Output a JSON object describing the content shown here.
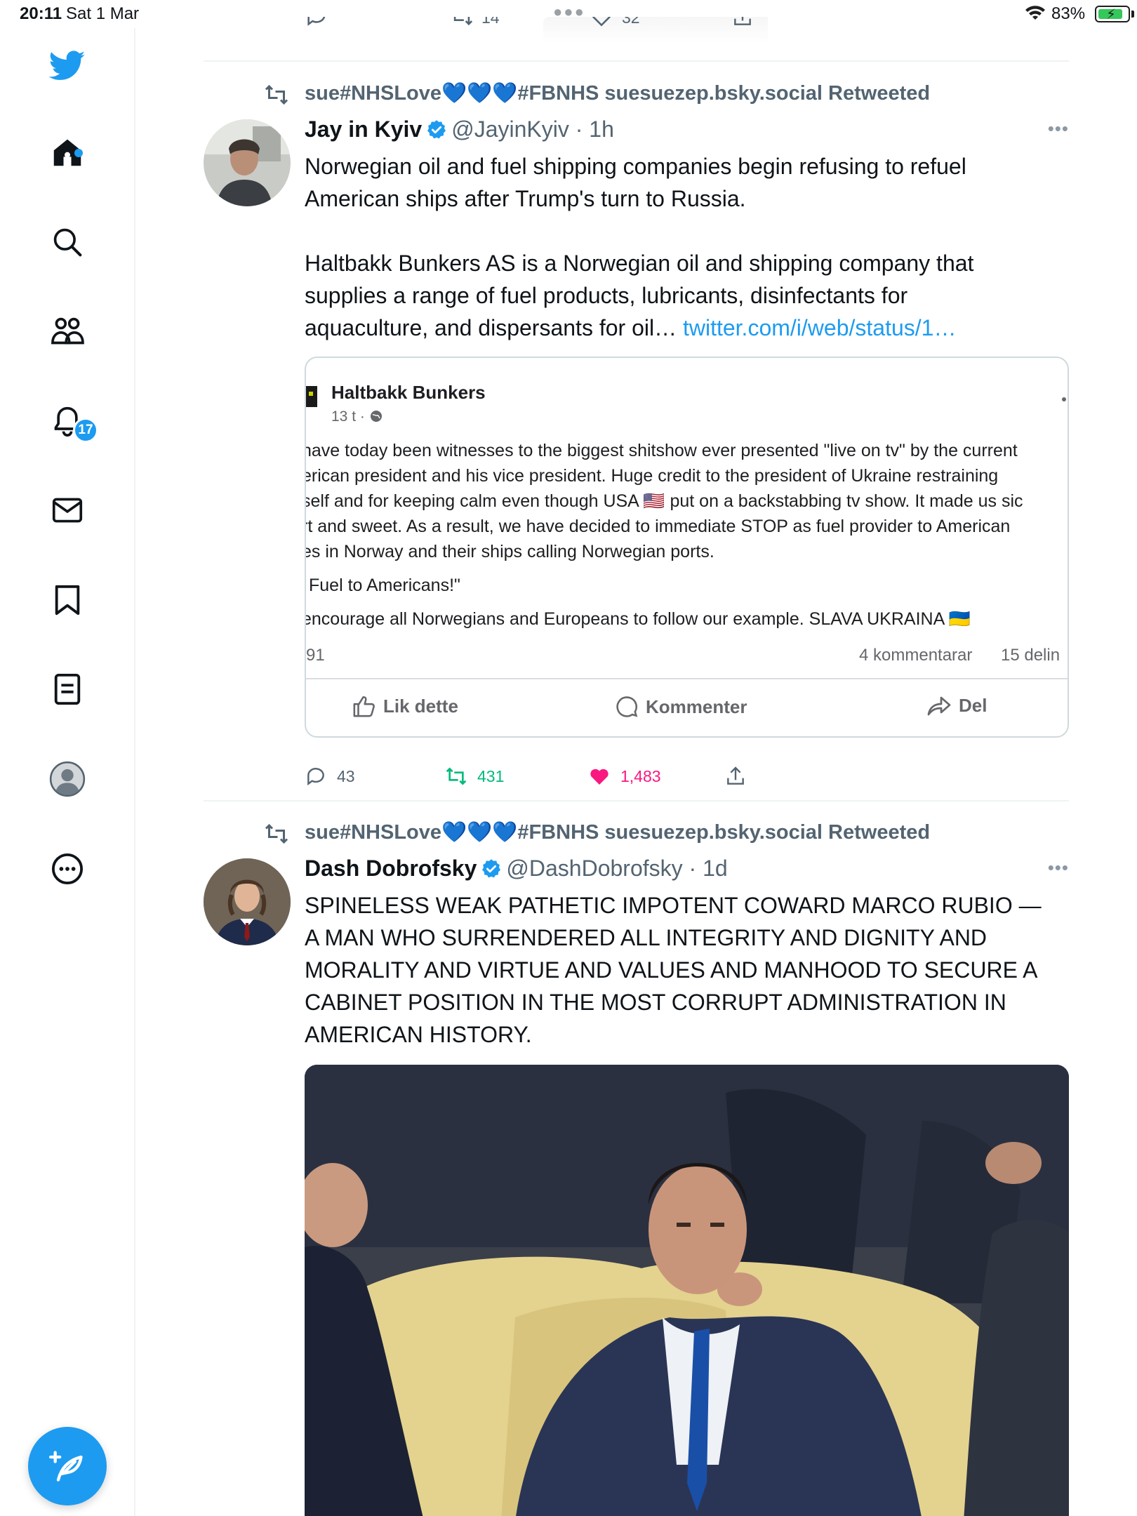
{
  "status_bar": {
    "time": "20:11",
    "date": "Sat 1 Mar",
    "battery": "83%"
  },
  "sidebar": {
    "notifications_badge": "17",
    "items": [
      "twitter-logo",
      "home-icon",
      "search-icon",
      "communities-icon",
      "notifications-icon",
      "messages-icon",
      "bookmarks-icon",
      "lists-icon",
      "profile-icon",
      "more-icon"
    ]
  },
  "top_partial_tweet": {
    "retweets": "14",
    "likes": "32"
  },
  "tweets": [
    {
      "retweeted_by": "sue#NHSLove💙💙💙#FBNHS suesuezep.bsky.social Retweeted",
      "name": "Jay in Kyiv",
      "handle": "@JayinKyiv",
      "time": "· 1h",
      "body_line1": "Norwegian oil and fuel shipping companies begin refusing to refuel",
      "body_line2": "American ships after Trump's turn to Russia.",
      "body_line3": "Haltbakk Bunkers AS is a Norwegian oil and shipping company that",
      "body_line4": "supplies a range of fuel products, lubricants, disinfectants for",
      "body_line5": "aquaculture, and dispersants for oil…",
      "link": "twitter.com/i/web/status/1…",
      "card": {
        "page_name": "Haltbakk Bunkers",
        "page_time": "13 t ·",
        "line1": "have today been witnesses to the biggest shitshow ever presented \"live on tv\" by the current",
        "line2": "erican president and his vice president. Huge credit to the president of Ukraine restraining",
        "line3": "self and for keeping calm even though USA 🇺🇸 put on a backstabbing tv show. It made us sic",
        "line4": "rt and sweet. As a result, we have decided to immediate STOP as fuel provider to American",
        "line5": "es in Norway and their ships calling Norwegian ports.",
        "line6": "Fuel to Americans!\"",
        "line7": "encourage all Norwegians and Europeans to follow our example. SLAVA UKRAINA 🇺🇦",
        "reactions": "91",
        "comments": "4 kommentarar",
        "shares": "15 delin",
        "like_label": "Lik dette",
        "comment_label": "Kommenter",
        "share_label": "Del"
      },
      "replies": "43",
      "retweets": "431",
      "likes": "1,483"
    },
    {
      "retweeted_by": "sue#NHSLove💙💙💙#FBNHS suesuezep.bsky.social Retweeted",
      "name": "Dash Dobrofsky",
      "handle": "@DashDobrofsky",
      "time": "· 1d",
      "body_line1": "SPINELESS WEAK PATHETIC IMPOTENT COWARD MARCO RUBIO —",
      "body_line2": "A MAN WHO SURRENDERED ALL INTEGRITY AND DIGNITY AND",
      "body_line3": "MORALITY AND VIRTUE AND VALUES AND MANHOOD TO SECURE A",
      "body_line4": "CABINET POSITION IN THE MOST CORRUPT ADMINISTRATION IN",
      "body_line5": "AMERICAN HISTORY."
    }
  ],
  "colors": {
    "accent": "#1d9bf0",
    "retweet_green": "#00ba7c",
    "like_pink": "#f91880",
    "muted": "#536471"
  }
}
